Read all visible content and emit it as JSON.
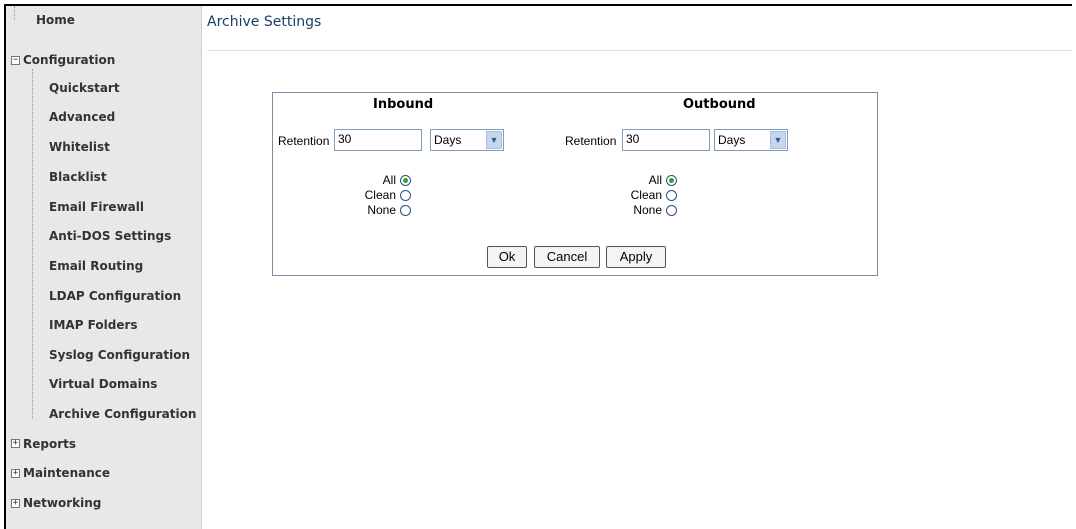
{
  "sidebar": {
    "home": "Home",
    "configuration": {
      "label": "Configuration",
      "toggle": "⊟",
      "items": [
        "Quickstart",
        "Advanced",
        "Whitelist",
        "Blacklist",
        "Email Firewall",
        "Anti-DOS Settings",
        "Email Routing",
        "LDAP Configuration",
        "IMAP Folders",
        "Syslog Configuration",
        "Virtual Domains",
        "Archive Configuration"
      ]
    },
    "reports": "Reports",
    "maintenance": "Maintenance",
    "networking": "Networking"
  },
  "main": {
    "title": "Archive Settings",
    "inbound": {
      "heading": "Inbound",
      "retention_label": "Retention",
      "retention_value": "30",
      "unit": "Days",
      "options": [
        "All",
        "Clean",
        "None"
      ],
      "selected": "All"
    },
    "outbound": {
      "heading": "Outbound",
      "retention_label": "Retention",
      "retention_value": "30",
      "unit": "Days",
      "options": [
        "All",
        "Clean",
        "None"
      ],
      "selected": "All"
    },
    "buttons": {
      "ok": "Ok",
      "cancel": "Cancel",
      "apply": "Apply"
    }
  },
  "colors": {
    "title": "#1a3d66",
    "sidebar_bg": "#e8e8e8",
    "radio_selected": "#2da42d"
  }
}
